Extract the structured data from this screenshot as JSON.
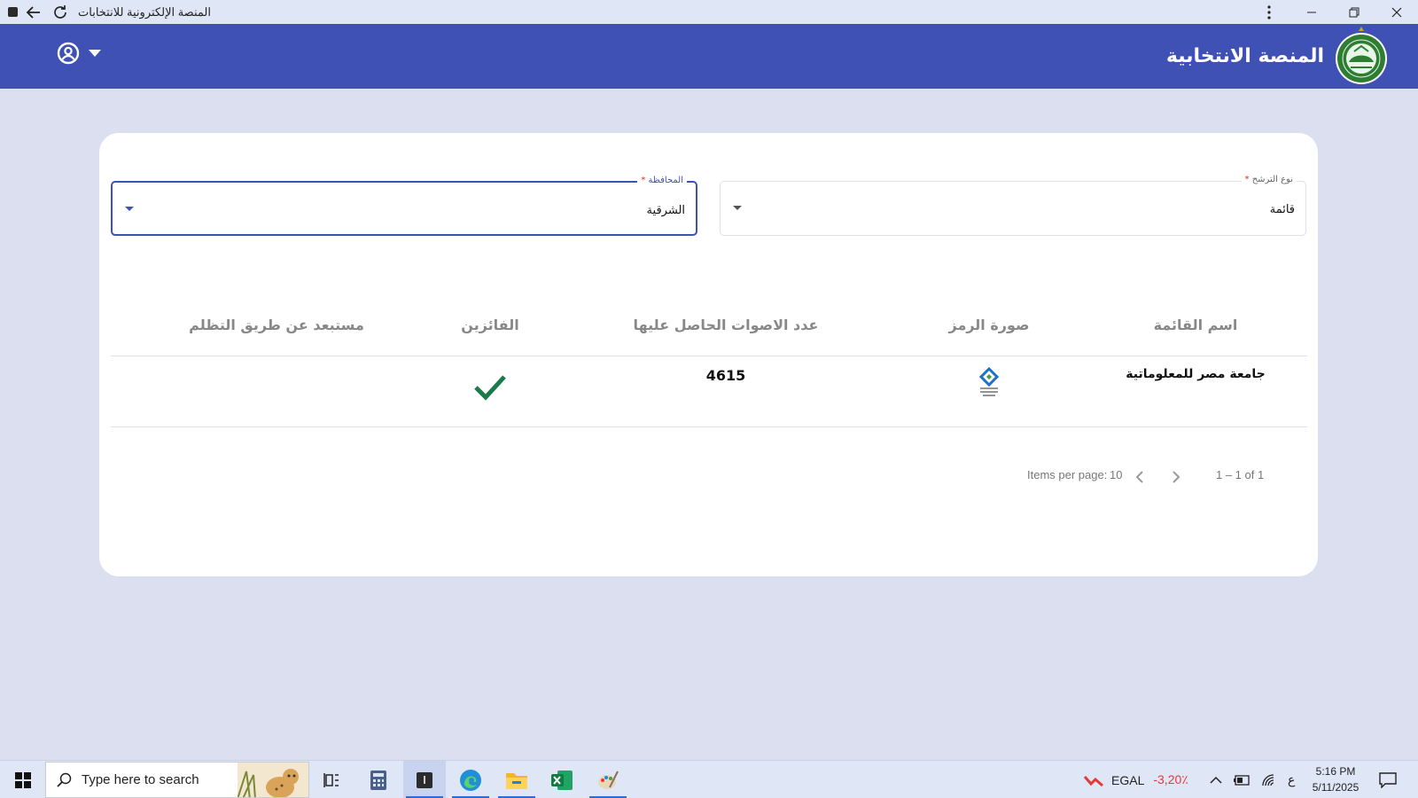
{
  "window": {
    "title": "المنصة الإلكترونية للانتخابات"
  },
  "header": {
    "brand_title": "المنصة الانتخابية",
    "brand_color": "#3f51b5"
  },
  "filters": {
    "candidacy_type": {
      "label": "نوع الترشح",
      "required_mark": "*",
      "value": "قائمة"
    },
    "governorate": {
      "label": "المحافظة",
      "required_mark": "*",
      "value": "الشرقية"
    }
  },
  "table": {
    "columns": [
      "اسم القائمة",
      "صورة الرمز",
      "عدد الاصوات الحاصل عليها",
      "الفائزين",
      "مستبعد عن طريق التظلم"
    ],
    "rows": [
      {
        "list_name": "جامعة مصر للمعلوماتية",
        "symbol_icon": "list-symbol-logo",
        "votes": "4615",
        "winner": true,
        "excluded": ""
      }
    ]
  },
  "paginator": {
    "items_per_page_label": "Items per page:",
    "items_per_page_value": "10",
    "range_label": "1 – 1 of 1"
  },
  "taskbar": {
    "search_placeholder": "Type here to search",
    "stock_ticker": "EGAL",
    "stock_change": "-3,20٪",
    "keyboard_lang": "ع",
    "time": "5:16 PM",
    "date": "5/11/2025"
  },
  "colors": {
    "accent": "#3f51b5",
    "page_bg": "#dcdff0",
    "winner_check": "#1b7a4a",
    "required": "#d32f2f"
  }
}
